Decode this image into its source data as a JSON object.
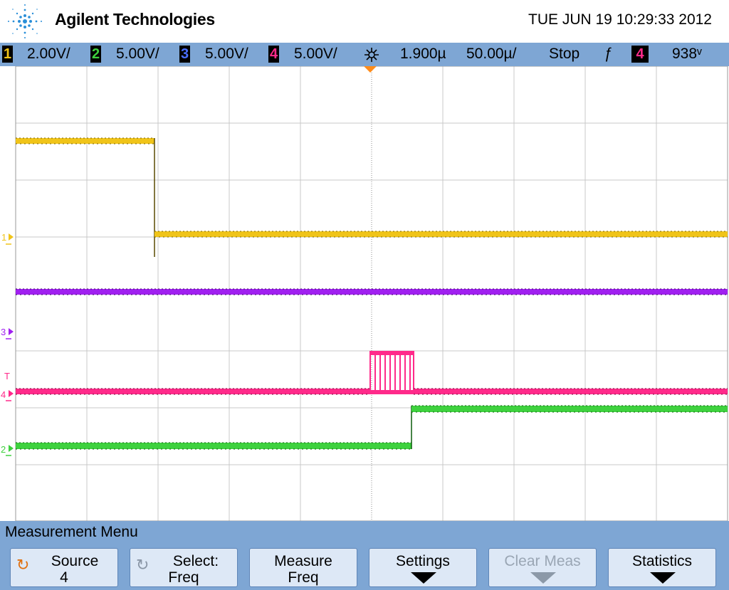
{
  "header": {
    "brand": "Agilent Technologies",
    "datetime": "TUE JUN 19 10:29:33 2012"
  },
  "status": {
    "ch1": {
      "num": "1",
      "scale": "2.00V/",
      "color": "#f0c419"
    },
    "ch2": {
      "num": "2",
      "scale": "5.00V/",
      "color": "#3ed13e"
    },
    "ch3": {
      "num": "3",
      "scale": "5.00V/",
      "color": "#4a6fff"
    },
    "ch4": {
      "num": "4",
      "scale": "5.00V/",
      "color": "#ff2a8a"
    },
    "delay": "1.900µ",
    "timebase": "50.00µ/",
    "run_state": "Stop",
    "trigger_slope": "ƒ",
    "trigger_source": "4",
    "trigger_level": "938ᵛ"
  },
  "markers": {
    "ch1": "1",
    "ch3": "3",
    "trigger": "T",
    "ch4": "4",
    "ch2": "2"
  },
  "menu": {
    "title": "Measurement Menu",
    "keys": [
      {
        "line1": "Source",
        "line2": "4"
      },
      {
        "line1": "Select:",
        "line2": "Freq"
      },
      {
        "line1": "Measure",
        "line2": "Freq"
      },
      {
        "line1": "Settings",
        "line2": ""
      },
      {
        "line1": "Clear Meas",
        "line2": ""
      },
      {
        "line1": "Statistics",
        "line2": ""
      }
    ]
  },
  "colors": {
    "menu_bg": "#7ea6d4",
    "ch1": "#f0c419",
    "ch2": "#3ed13e",
    "ch3": "#a020f0",
    "ch4": "#ff2a8a",
    "trigger_marker": "#ff8c1a"
  }
}
